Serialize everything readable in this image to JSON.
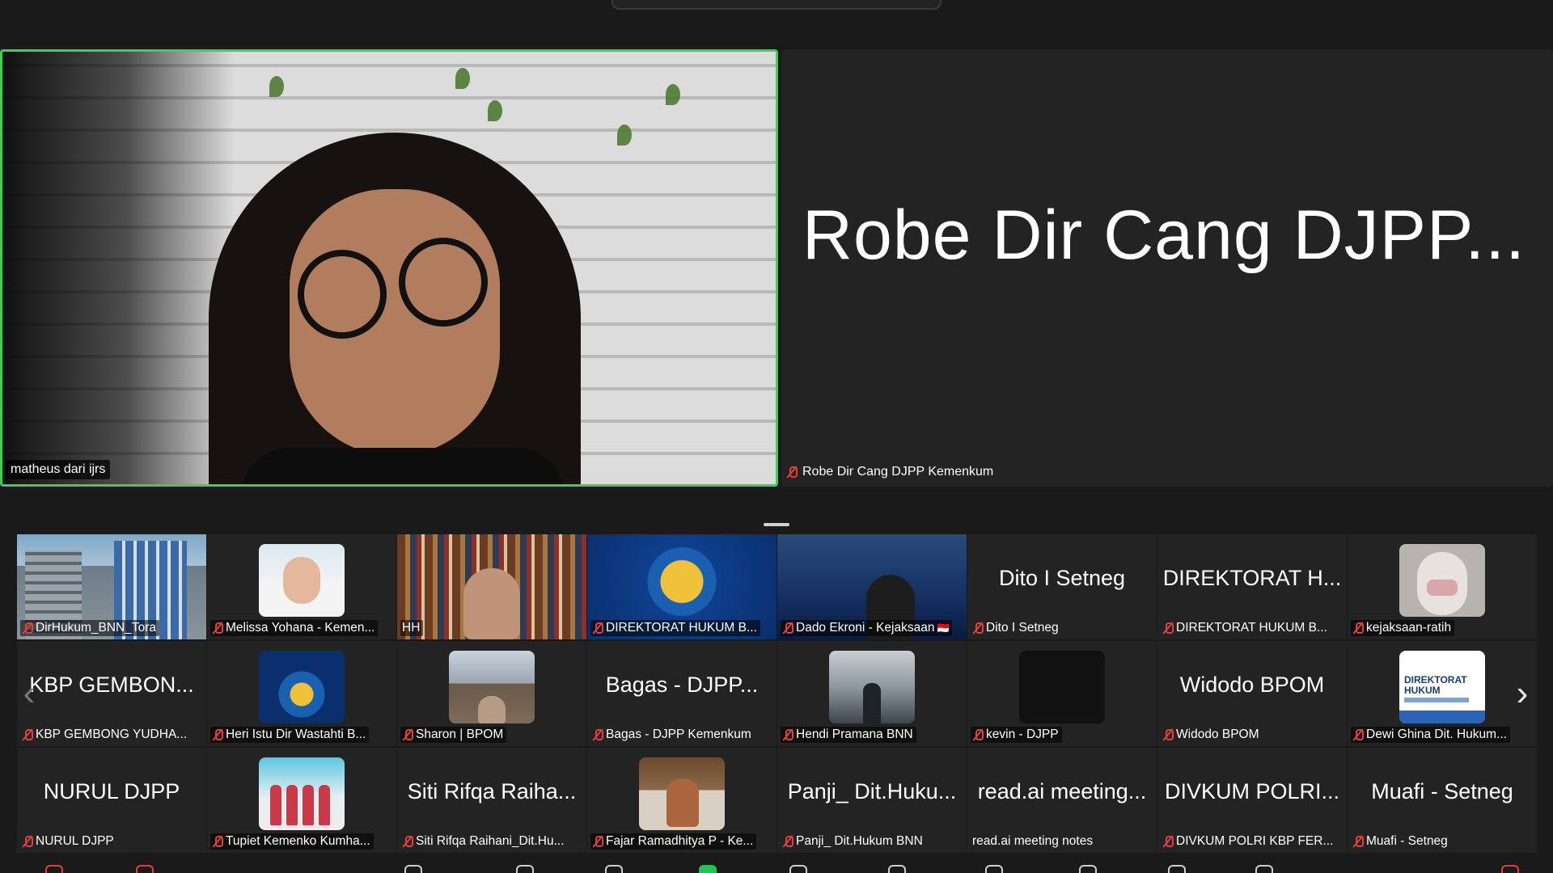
{
  "main_speaker": {
    "name": "matheus dari ijrs"
  },
  "second_speaker": {
    "display_name": "Robe Dir Cang DJPP...",
    "name": "Robe Dir Cang DJPP Kemenkum",
    "muted": true
  },
  "gallery": {
    "rows": [
      [
        {
          "label": "DirHukum_BNN_Tora",
          "muted": true,
          "video": "building"
        },
        {
          "label": "Melissa Yohana - Kemen...",
          "muted": true,
          "video": "portrait"
        },
        {
          "label": "HH",
          "muted": false,
          "video": "bookshelf"
        },
        {
          "label": "DIREKTORAT HUKUM B...",
          "muted": true,
          "video": "bnn-logo"
        },
        {
          "label": "Dado Ekroni - Kejaksaan",
          "muted": true,
          "video": "stage",
          "flag": "🇮🇩"
        },
        {
          "label": "Dito I Setneg",
          "muted": true,
          "initials": "Dito I Setneg"
        },
        {
          "label": "DIREKTORAT HUKUM B...",
          "muted": true,
          "initials": "DIREKTORAT H..."
        },
        {
          "label": "kejaksaan-ratih",
          "muted": true,
          "video": "hijab"
        }
      ],
      [
        {
          "label": "KBP GEMBONG YUDHA...",
          "muted": true,
          "initials": "KBP GEMBON..."
        },
        {
          "label": "Heri Istu Dir Wastahti B...",
          "muted": true,
          "video": "bnn-logo-small"
        },
        {
          "label": "Sharon | BPOM",
          "muted": true,
          "video": "palace"
        },
        {
          "label": "Bagas - DJPP Kemenkum",
          "muted": true,
          "initials": "Bagas - DJPP..."
        },
        {
          "label": "Hendi Pramana BNN",
          "muted": true,
          "video": "mountain"
        },
        {
          "label": "kevin - DJPP",
          "muted": true,
          "video": "dark"
        },
        {
          "label": "Widodo BPOM",
          "muted": true,
          "initials": "Widodo BPOM"
        },
        {
          "label": "Dewi Ghina Dit. Hukum...",
          "muted": true,
          "video": "document",
          "doc_title": "DIREKTORAT HUKUM"
        }
      ],
      [
        {
          "label": "NURUL DJPP",
          "muted": true,
          "initials": "NURUL DJPP"
        },
        {
          "label": "Tupiet Kemenko Kumha...",
          "muted": true,
          "video": "group"
        },
        {
          "label": "Siti Rifqa Raihani_Dit.Hu...",
          "muted": true,
          "initials": "Siti Rifqa Raiha..."
        },
        {
          "label": "Fajar Ramadhitya P - Ke...",
          "muted": true,
          "video": "office"
        },
        {
          "label": "Panji_ Dit.Hukum BNN",
          "muted": true,
          "initials": "Panji_ Dit.Huku..."
        },
        {
          "label": "read.ai meeting notes",
          "muted": false,
          "initials": "read.ai meeting..."
        },
        {
          "label": "DIVKUM POLRI KBP FER...",
          "muted": true,
          "initials": "DIVKUM POLRI..."
        },
        {
          "label": "Muafi - Setneg",
          "muted": true,
          "initials": "Muafi - Setneg"
        }
      ]
    ],
    "prev_arrow": "‹",
    "next_arrow": "›"
  },
  "colors": {
    "active_speaker_border": "#3ecf4f",
    "muted_icon": "#e3403a",
    "background": "#1a1a1a"
  },
  "icons": [
    "mic-off-icon",
    "chevron-left-icon",
    "chevron-right-icon"
  ]
}
